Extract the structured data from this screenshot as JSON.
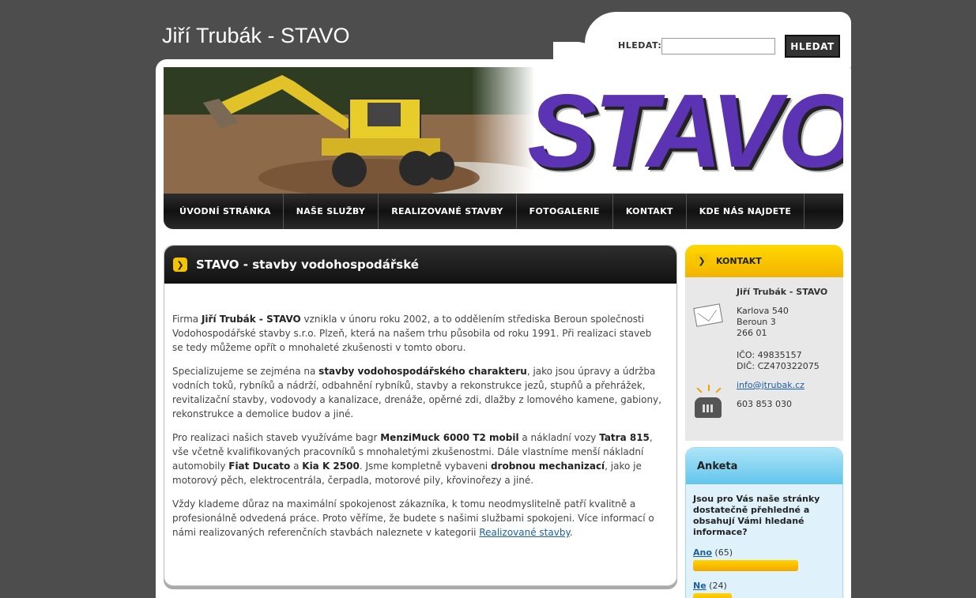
{
  "header": {
    "site_title": "Jiří Trubák - STAVO"
  },
  "search": {
    "label": "HLEDAT:",
    "input_value": "",
    "button_label": "HLEDAT"
  },
  "banner": {
    "logo_text": "STAVO"
  },
  "nav": {
    "items": [
      {
        "label": "ÚVODNÍ STRÁNKA"
      },
      {
        "label": "NAŠE SLUŽBY"
      },
      {
        "label": "REALIZOVANÉ STAVBY"
      },
      {
        "label": "FOTOGALERIE"
      },
      {
        "label": "KONTAKT"
      },
      {
        "label": "KDE NÁS NAJDETE"
      }
    ]
  },
  "main": {
    "title": "STAVO - stavby vodohospodářské",
    "p1": {
      "t1": "Firma ",
      "b1": "Jiří Trubák - STAVO",
      "t2": " vznikla v únoru roku 2002, a to oddělením střediska Beroun společnosti Vodohospodářské stavby s.r.o. Plzeň, která na našem trhu působila od roku 1991. Při realizaci staveb se tedy můžeme opřít o mnohaleté zkušenosti v tomto oboru."
    },
    "p2": {
      "t1": "Specializujeme se zejména na ",
      "b1": "stavby vodohospodářského charakteru",
      "t2": ", jako jsou úpravy a údržba vodních toků, rybníků a nádrží, odbahnění rybníků, stavby a rekonstrukce jezů, stupňů a přehrážek, revitalizační stavby, vodovody a kanalizace, drenáže, opěrné zdi, dlažby z lomového kamene, gabiony, rekonstrukce a demolice budov a jiné."
    },
    "p3": {
      "t1": "Pro realizaci našich staveb využíváme bagr ",
      "b1": "MenziMuck 6000 T2 mobil",
      "t2": " a nákladní vozy ",
      "b2": "Tatra 815",
      "t3": ", vše včetně kvalifikovaných pracovníků s mnohaletými zkušenostmi. Dále vlastníme menší nákladní automobily ",
      "b3": "Fiat Ducato",
      "t4": " a ",
      "b4": "Kia K 2500",
      "t5": ". Jsme kompletně vybaveni ",
      "b5": "drobnou mechanizací",
      "t6": ", jako je motorový pěch, elektrocentrála, čerpadla, motorové pily, křovinořezy a jiné."
    },
    "p4": {
      "t1": "Vždy klademe důraz na maximální spokojenost zákazníka, k tomu neodmyslitelně patří kvalitně a profesionálně odvedená práce. Proto věříme, že budete s našimi službami spokojeni. Více informací o námi realizovaných referenčních stavbách naleznete v kategorii ",
      "link": "Realizované stavby",
      "t2": "."
    }
  },
  "contact": {
    "title": "KONTAKT",
    "name": "Jiří Trubák - STAVO",
    "street": "Karlova 540",
    "city": "Beroun 3",
    "zip": "266 01",
    "ico": "IČO: 49835157",
    "dic": "DIČ: CZ470322075",
    "email": "info@jtrubak.cz",
    "phone": "603 853 030"
  },
  "poll": {
    "title": "Anketa",
    "question": "Jsou pro Vás naše stránky dostatečně přehledné a obsahují Vámi hledané informace?",
    "options": [
      {
        "label": "Ano",
        "count": "(65)",
        "share": 0.73
      },
      {
        "label": "Ne",
        "count": "(24)",
        "share": 0.27
      }
    ]
  },
  "colors": {
    "accent": "#f5c400",
    "logo": "#5c34b3",
    "link": "#1a5fa5"
  }
}
